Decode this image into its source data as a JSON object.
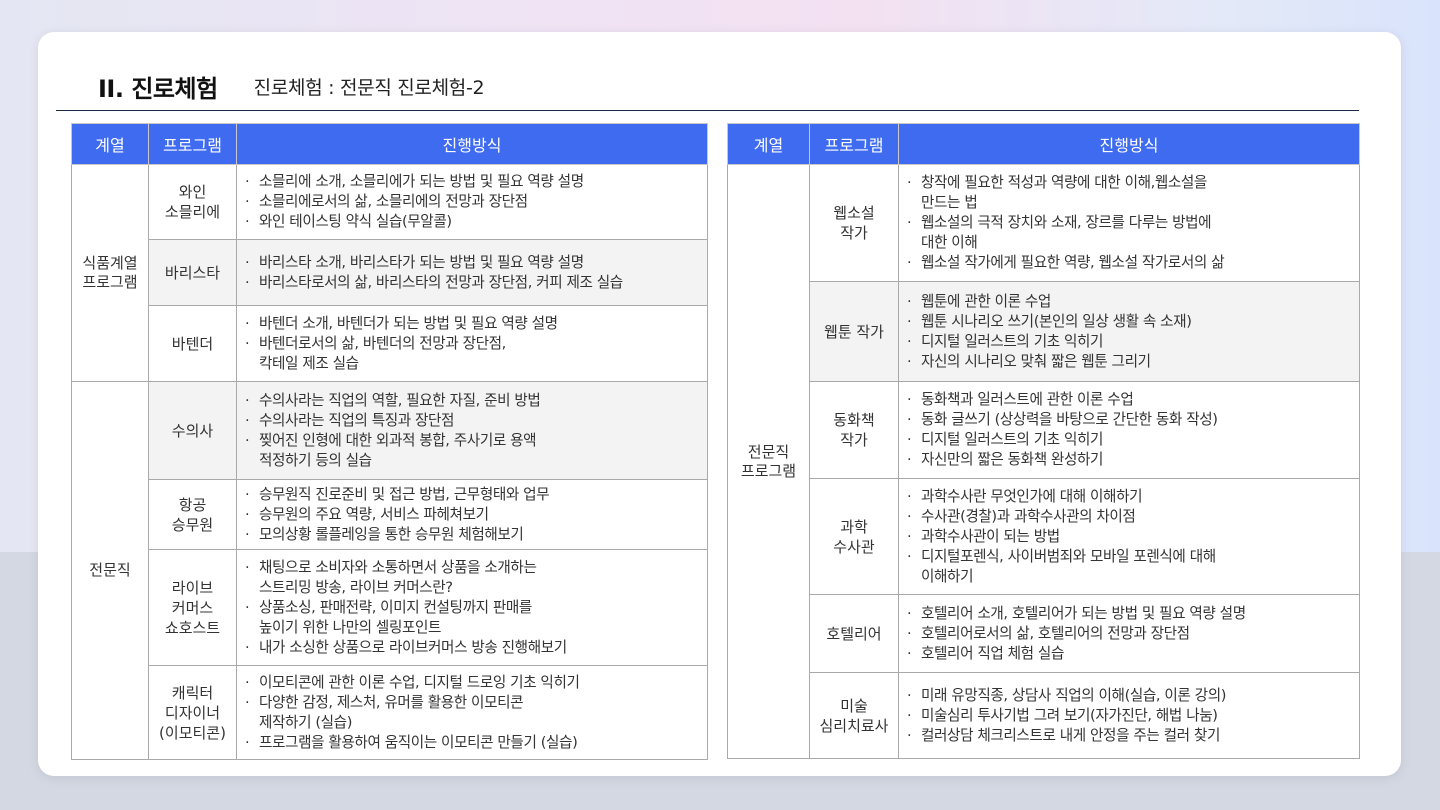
{
  "section_title": "II. 진로체험",
  "subtitle": "진로체험 : 전문직 진로체험-2",
  "headers": {
    "category": "계열",
    "program": "프로그램",
    "method": "진행방식"
  },
  "left": {
    "groups": [
      {
        "category": "식품계열\n프로그램",
        "rows": [
          {
            "program": "와인\n소믈리에",
            "items": [
              "소믈리에 소개, 소믈리에가 되는 방법 및 필요 역량 설명",
              "소믈리에로서의 삶, 소믈리에의 전망과 장단점",
              "와인 테이스팅 약식 실습(무알콜)"
            ]
          },
          {
            "program": "바리스타",
            "items": [
              "바리스타 소개, 바리스타가 되는 방법 및 필요 역량 설명",
              "바리스타로서의 삶, 바리스타의 전망과 장단점, 커피 제조 실습"
            ]
          },
          {
            "program": "바텐더",
            "items": [
              "바텐더 소개, 바텐더가 되는 방법 및 필요 역량 설명",
              "바텐더로서의 삶, 바텐더의 전망과 장단점,\n칵테일 제조 실습"
            ]
          }
        ]
      },
      {
        "category": "전문직",
        "rows": [
          {
            "program": "수의사",
            "items": [
              "수의사라는 직업의 역할, 필요한 자질, 준비 방법",
              "수의사라는 직업의 특징과 장단점",
              "찢어진 인형에 대한 외과적 봉합, 주사기로 용액\n적정하기 등의 실습"
            ]
          },
          {
            "program": "항공\n승무원",
            "items": [
              "승무원직 진로준비 및 접근 방법, 근무형태와 업무",
              "승무원의 주요 역량, 서비스 파헤쳐보기",
              "모의상황 롤플레잉을 통한 승무원 체험해보기"
            ]
          },
          {
            "program": "라이브\n커머스\n쇼호스트",
            "items": [
              "채팅으로 소비자와 소통하면서 상품을 소개하는\n스트리밍 방송, 라이브 커머스란?",
              "상품소싱, 판매전략, 이미지 컨설팅까지 판매를\n높이기 위한 나만의 셀링포인트",
              "내가 소싱한 상품으로 라이브커머스 방송 진행해보기"
            ]
          },
          {
            "program": "캐릭터\n디자이너\n(이모티콘)",
            "items": [
              "이모티콘에 관한 이론 수업, 디지털 드로잉 기초 익히기",
              "다양한 감정, 제스처, 유머를 활용한 이모티콘\n제작하기 (실습)",
              "프로그램을 활용하여 움직이는 이모티콘 만들기 (실습)"
            ]
          }
        ]
      }
    ]
  },
  "right": {
    "groups": [
      {
        "category": "전문직\n프로그램",
        "rows": [
          {
            "program": "웹소설\n작가",
            "items": [
              "창작에 필요한 적성과 역량에 대한 이해,웹소설을\n만드는 법",
              "웹소설의 극적 장치와 소재, 장르를 다루는 방법에\n대한 이해",
              "웹소설 작가에게 필요한 역량, 웹소설 작가로서의 삶"
            ]
          },
          {
            "program": "웹툰 작가",
            "items": [
              "웹툰에 관한 이론 수업",
              "웹툰 시나리오 쓰기(본인의 일상 생활 속 소재)",
              "디지털 일러스트의 기초 익히기",
              "자신의 시나리오 맞춰 짧은 웹툰 그리기"
            ]
          },
          {
            "program": "동화책\n작가",
            "items": [
              "동화책과 일러스트에 관한 이론 수업",
              "동화 글쓰기 (상상력을 바탕으로 간단한 동화 작성)",
              "디지털 일러스트의 기초 익히기",
              "자신만의 짧은 동화책 완성하기"
            ]
          },
          {
            "program": "과학\n수사관",
            "items": [
              "과학수사란 무엇인가에 대해 이해하기",
              "수사관(경찰)과 과학수사관의 차이점",
              "과학수사관이 되는 방법",
              "디지털포렌식, 사이버범죄와 모바일 포렌식에 대해\n이해하기"
            ]
          },
          {
            "program": "호텔리어",
            "items": [
              "호텔리어 소개, 호텔리어가 되는 방법 및 필요 역량 설명",
              "호텔리어로서의 삶, 호텔리어의 전망과 장단점",
              "호텔리어 직업 체험 실습"
            ]
          },
          {
            "program": "미술\n심리치료사",
            "items": [
              "미래 유망직종, 상담사 직업의 이해(실습, 이론 강의)",
              "미술심리 투사기법 그려 보기(자가진단, 해법 나눔)",
              "컬러상담 체크리스트로 내게 안정을 주는 컬러 찾기"
            ]
          }
        ]
      }
    ]
  }
}
